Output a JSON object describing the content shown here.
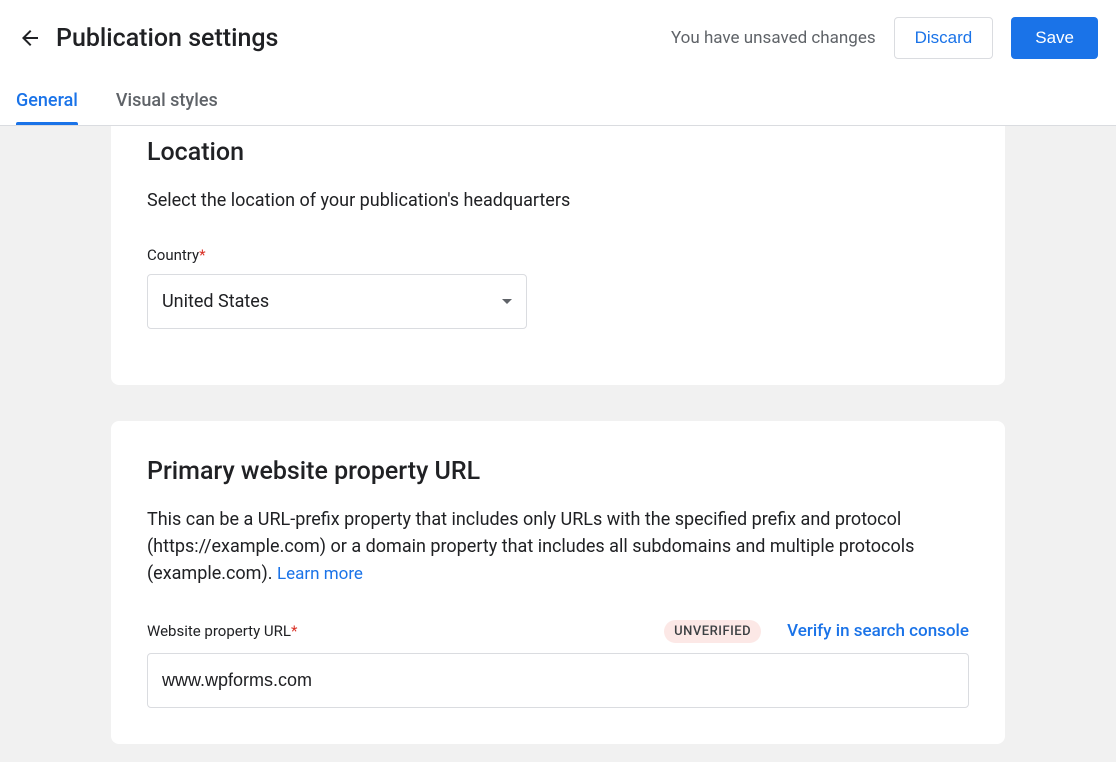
{
  "header": {
    "title": "Publication settings",
    "unsaved_message": "You have unsaved changes",
    "discard_label": "Discard",
    "save_label": "Save"
  },
  "tabs": {
    "general": "General",
    "visual_styles": "Visual styles"
  },
  "location": {
    "heading": "Location",
    "description": "Select the location of your publication's headquarters",
    "country_label": "Country",
    "country_value": "United States"
  },
  "url_section": {
    "heading": "Primary website property URL",
    "description": "This can be a URL-prefix property that includes only URLs with the specified prefix and protocol (https://example.com) or a domain property that includes all subdomains and multiple protocols (example.com). ",
    "learn_more": "Learn more",
    "field_label": "Website property URL",
    "badge": "UNVERIFIED",
    "verify_link": "Verify in search console",
    "input_value": "www.wpforms.com"
  }
}
